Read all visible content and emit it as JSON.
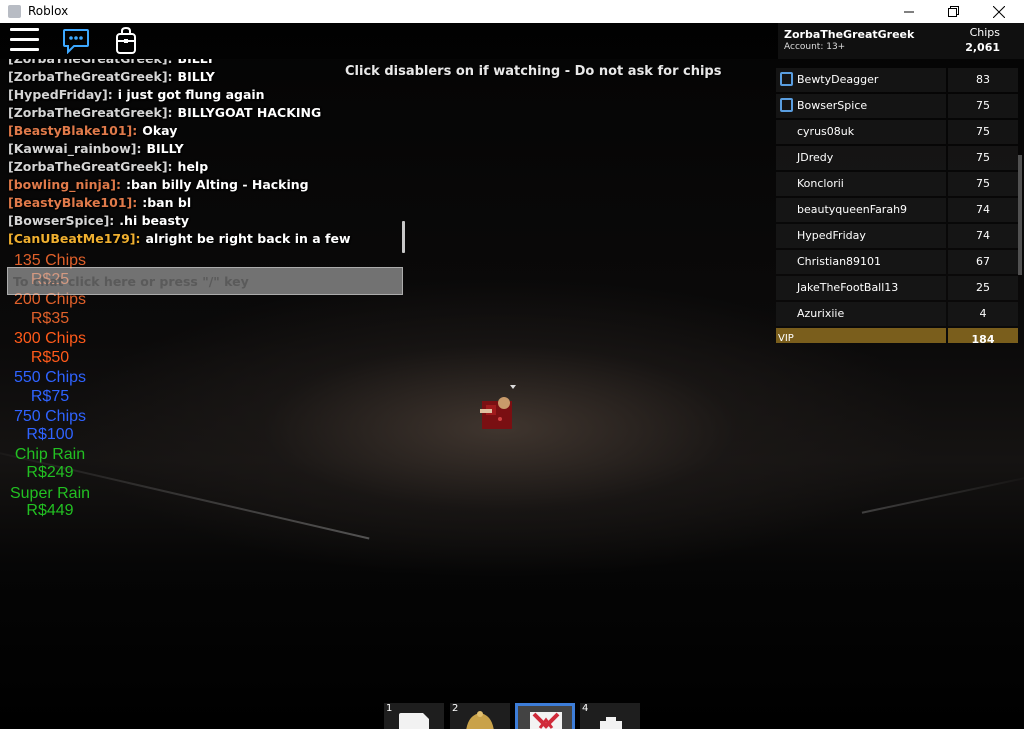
{
  "window": {
    "title": "Roblox"
  },
  "notice": "Click disablers on if watching - Do not ask for chips",
  "player_header": {
    "name": "ZorbaTheGreatGreek",
    "account": "Account: 13+",
    "stat_name": "Chips",
    "stat_value": "2,061"
  },
  "chat": {
    "placeholder": "To chat click here or press \"/\" key",
    "lines": [
      {
        "name": "[ZorbaTheGreatGreek]:",
        "msg": "BILLY",
        "color": "#d5d5d5"
      },
      {
        "name": "[ZorbaTheGreatGreek]:",
        "msg": "BILLY",
        "color": "#d5d5d5"
      },
      {
        "name": "[HypedFriday]:",
        "msg": "i just got flung again",
        "color": "#d5d5d5"
      },
      {
        "name": "[ZorbaTheGreatGreek]:",
        "msg": "BILLYGOAT HACKING",
        "color": "#d5d5d5"
      },
      {
        "name": "[BeastyBlake101]:",
        "msg": "Okay",
        "color": "#e07a4a"
      },
      {
        "name": "[Kawwai_rainbow]:",
        "msg": "BILLY",
        "color": "#d5d5d5"
      },
      {
        "name": "[ZorbaTheGreatGreek]:",
        "msg": "help",
        "color": "#d5d5d5"
      },
      {
        "name": "[bowling_ninja]:",
        "msg": ":ban billy Alting - Hacking",
        "color": "#e07a4a"
      },
      {
        "name": "[BeastyBlake101]:",
        "msg": ":ban bl",
        "color": "#e07a4a"
      },
      {
        "name": "[BowserSpice]:",
        "msg": ".hi beasty",
        "color": "#d5d5d5"
      },
      {
        "name": "[CanUBeatMe179]:",
        "msg": "alright be right back in a few",
        "color": "#f0b030"
      }
    ]
  },
  "shop": {
    "items": [
      {
        "label": "135 Chips",
        "color": "#e0602a"
      },
      {
        "label": "R$25",
        "color": "#e0602a"
      },
      {
        "label": "200 Chips",
        "color": "#e0602a"
      },
      {
        "label": "R$35",
        "color": "#e0602a"
      },
      {
        "label": "300 Chips",
        "color": "#ff5a1a"
      },
      {
        "label": "R$50",
        "color": "#ff5a1a"
      },
      {
        "label": "550 Chips",
        "color": "#2f63ff"
      },
      {
        "label": "R$75",
        "color": "#2f63ff"
      },
      {
        "label": "750 Chips",
        "color": "#2f63ff"
      },
      {
        "label": "R$100",
        "color": "#2f63ff"
      },
      {
        "label": "Chip Rain",
        "color": "#22c022"
      },
      {
        "label": "R$249",
        "color": "#22c022"
      },
      {
        "label": "Super Rain",
        "color": "#22c022"
      },
      {
        "label": "R$449",
        "color": "#22c022"
      }
    ]
  },
  "leaderboard": {
    "rows": [
      {
        "name": "BewtyDeagger",
        "value": "83",
        "badge": true
      },
      {
        "name": "BowserSpice",
        "value": "75",
        "badge": true
      },
      {
        "name": "cyrus08uk",
        "value": "75",
        "badge": false
      },
      {
        "name": "JDredy",
        "value": "75",
        "badge": false
      },
      {
        "name": "Konclorii",
        "value": "75",
        "badge": false
      },
      {
        "name": "beautyqueenFarah9",
        "value": "74",
        "badge": false
      },
      {
        "name": "HypedFriday",
        "value": "74",
        "badge": false
      },
      {
        "name": "Christian89101",
        "value": "67",
        "badge": false
      },
      {
        "name": "JakeTheFootBall13",
        "value": "25",
        "badge": false
      },
      {
        "name": "Azurixiie",
        "value": "4",
        "badge": false
      }
    ],
    "vip": {
      "name": "VIP",
      "value": "184"
    }
  },
  "hotbar": {
    "slots": [
      "1",
      "2",
      "3",
      "4"
    ]
  }
}
